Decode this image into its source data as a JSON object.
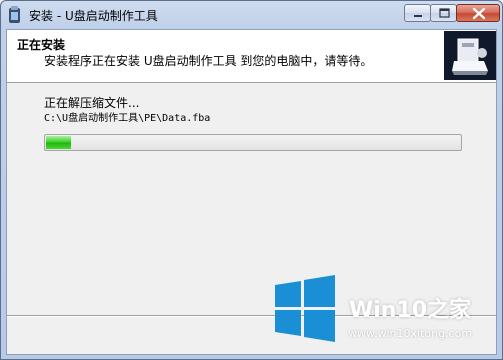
{
  "window": {
    "title": "安装 - U盘启动制作工具"
  },
  "header": {
    "title": "正在安装",
    "subtitle": "安装程序正在安装 U盘启动制作工具 到您的电脑中，请等待。"
  },
  "main": {
    "status": "正在解压缩文件...",
    "file_path": "C:\\U盘启动制作工具\\PE\\Data.fba",
    "progress_fraction": 0.06
  },
  "watermark": {
    "brand": "Win10之家",
    "url": "www.win10xitong.com"
  },
  "colors": {
    "progress_green": "#3fd32d",
    "title_bar": "#c5d5ed",
    "close_button": "#c44a33",
    "win_logo_blue": "#1a8fd6"
  },
  "icons": [
    "app-icon",
    "minimize-icon",
    "maximize-icon",
    "close-icon",
    "installer-logo",
    "windows-logo"
  ]
}
